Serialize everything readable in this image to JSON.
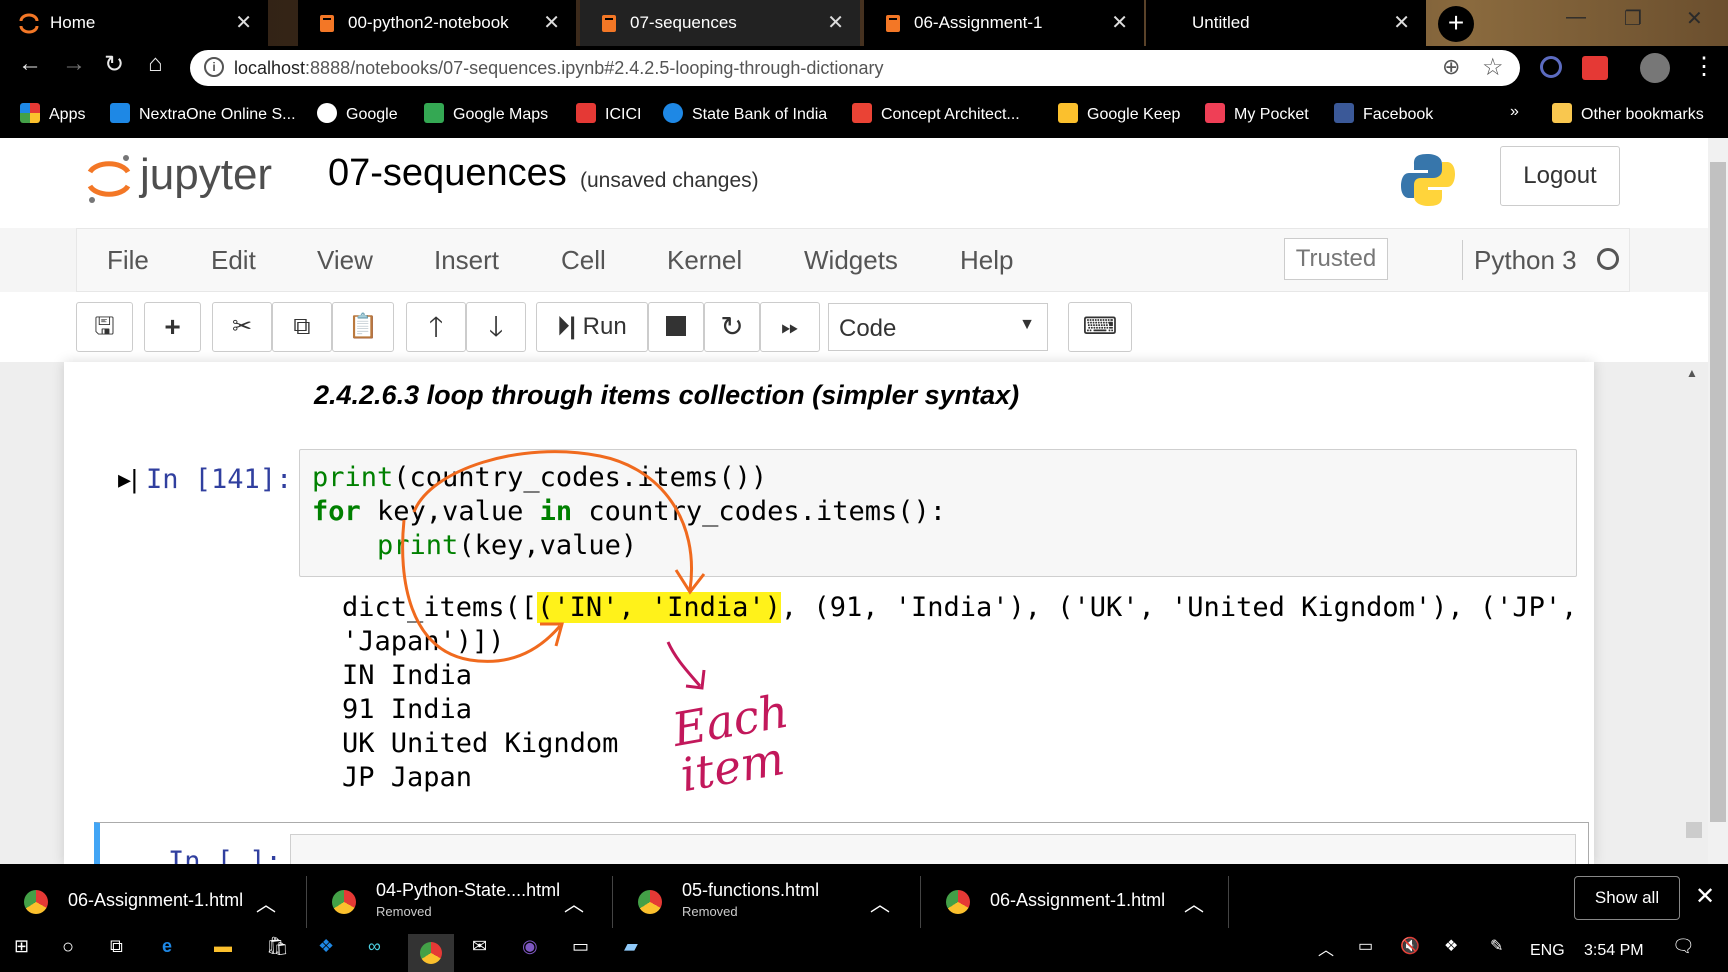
{
  "browser": {
    "tabs": [
      {
        "title": "Home",
        "icon": "jupyter-icon"
      },
      {
        "title": "00-python2-notebook",
        "icon": "notebook-icon"
      },
      {
        "title": "07-sequences",
        "icon": "notebook-icon",
        "active": true
      },
      {
        "title": "06-Assignment-1",
        "icon": "notebook-icon"
      },
      {
        "title": "Untitled",
        "icon": "none"
      }
    ],
    "url_host": "localhost",
    "url_rest": ":8888/notebooks/07-sequences.ipynb#2.4.2.5-looping-through-dictionary",
    "bookmarks": [
      {
        "label": "Apps",
        "color": "#e53935"
      },
      {
        "label": "NextraOne Online S...",
        "color": "#1e88e5"
      },
      {
        "label": "Google",
        "color": "#ffffff"
      },
      {
        "label": "Google Maps",
        "color": "#34a853"
      },
      {
        "label": "ICICI",
        "color": "#e53935"
      },
      {
        "label": "State Bank of India",
        "color": "#1e88e5"
      },
      {
        "label": "Concept Architect...",
        "color": "#ea4335"
      },
      {
        "label": "Google Keep",
        "color": "#fbc02d"
      },
      {
        "label": "My Pocket",
        "color": "#ef3f56"
      },
      {
        "label": "Facebook",
        "color": "#3b5998"
      },
      {
        "label": "»",
        "color": ""
      },
      {
        "label": "Other bookmarks",
        "color": "#f9c74f"
      }
    ]
  },
  "jupyter": {
    "logo_text": "jupyter",
    "notebook_title": "07-sequences",
    "save_status": "(unsaved changes)",
    "logout_label": "Logout",
    "menus": [
      "File",
      "Edit",
      "View",
      "Insert",
      "Cell",
      "Kernel",
      "Widgets",
      "Help"
    ],
    "trusted_label": "Trusted",
    "kernel_name": "Python 3",
    "run_label": "Run",
    "cell_type": "Code"
  },
  "cells": {
    "markdown_heading": "2.4.2.6.3 loop through items collection (simpler syntax)",
    "prompt": "In [141]:",
    "code": {
      "line1_fn": "print",
      "line1_rest": "(country_codes.items())",
      "line2_kw1": "for",
      "line2_mid": " key,value ",
      "line2_kw2": "in",
      "line2_rest": " country_codes.items():",
      "line3_indent": "    ",
      "line3_fn": "print",
      "line3_rest": "(key,value)"
    },
    "output": {
      "line1_pre": "dict_items([",
      "line1_hl": "('IN', 'India')",
      "line1_post": ", (91, 'India'), ('UK', 'United Kigndom'), ('JP',",
      "line2": "'Japan')])",
      "line3": "IN India",
      "line4": "91 India",
      "line5": "UK United Kigndom",
      "line6": "JP Japan"
    },
    "annotation_text": "Each item",
    "next_prompt": "In [ ]:"
  },
  "downloads": [
    {
      "name": "06-Assignment-1.html",
      "sub": ""
    },
    {
      "name": "04-Python-State....html",
      "sub": "Removed"
    },
    {
      "name": "05-functions.html",
      "sub": "Removed"
    },
    {
      "name": "06-Assignment-1.html",
      "sub": ""
    }
  ],
  "download_bar": {
    "show_all": "Show all"
  },
  "taskbar": {
    "lang": "ENG",
    "time": "3:54 PM"
  }
}
